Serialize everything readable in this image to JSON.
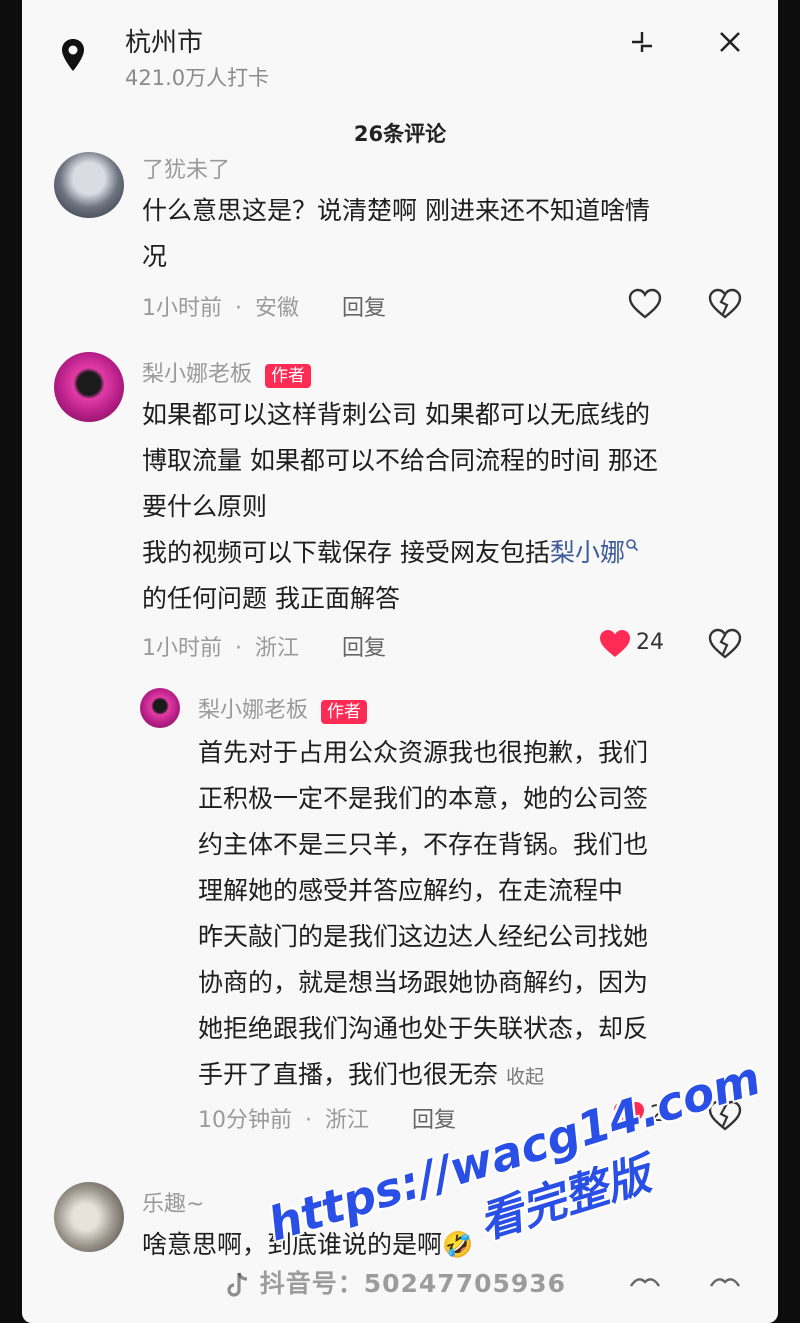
{
  "header": {
    "location_title": "杭州市",
    "location_sub": "421.0万人打卡",
    "comment_count": "26条评论"
  },
  "comments": [
    {
      "user": "了犹未了",
      "text": "什么意思这是？说清楚啊 刚进来还不知道啥情况",
      "lines": [
        "什么意思这是？说清楚啊 刚进来还不知道啥情",
        "况"
      ],
      "time": "1小时前",
      "region": "安徽",
      "reply_label": "回复"
    },
    {
      "user": "梨小娜老板",
      "badge": "作者",
      "lines": [
        "如果都可以这样背刺公司 如果都可以无底线的",
        "博取流量 如果都可以不给合同流程的时间 那还",
        "要什么原则",
        "我的视频可以下载保存 接受网友包括",
        "的任何问题 我正面解答"
      ],
      "mention": "梨小娜",
      "time": "1小时前",
      "region": "浙江",
      "reply_label": "回复",
      "likes": "24"
    },
    {
      "user": "梨小娜老板",
      "badge": "作者",
      "lines": [
        "首先对于占用公众资源我也很抱歉，我们",
        "正积极一定不是我们的本意，她的公司签",
        "约主体不是三只羊，不存在背锅。我们也",
        "理解她的感受并答应解约，在走流程中",
        "昨天敲门的是我们这边达人经纪公司找她",
        "协商的，就是想当场跟她协商解约，因为",
        "她拒绝跟我们沟通也处于失联状态，却反",
        "手开了直播，我们也很无奈"
      ],
      "fold_label": "收起",
      "time": "10分钟前",
      "region": "浙江",
      "reply_label": "回复",
      "likes": "2"
    },
    {
      "user": "乐趣~",
      "text": "啥意思啊，到底谁说的是啊🤣"
    }
  ],
  "separator": "·",
  "watermark": {
    "url": "https://wacg14.com",
    "sub": "看完整版",
    "douyin": "抖音号：50247705936"
  },
  "colors": {
    "like_red": "#fe2c55",
    "badge_red": "#fe2c55",
    "mention_blue": "#3d5a98",
    "watermark_blue": "#2a4fe6"
  }
}
